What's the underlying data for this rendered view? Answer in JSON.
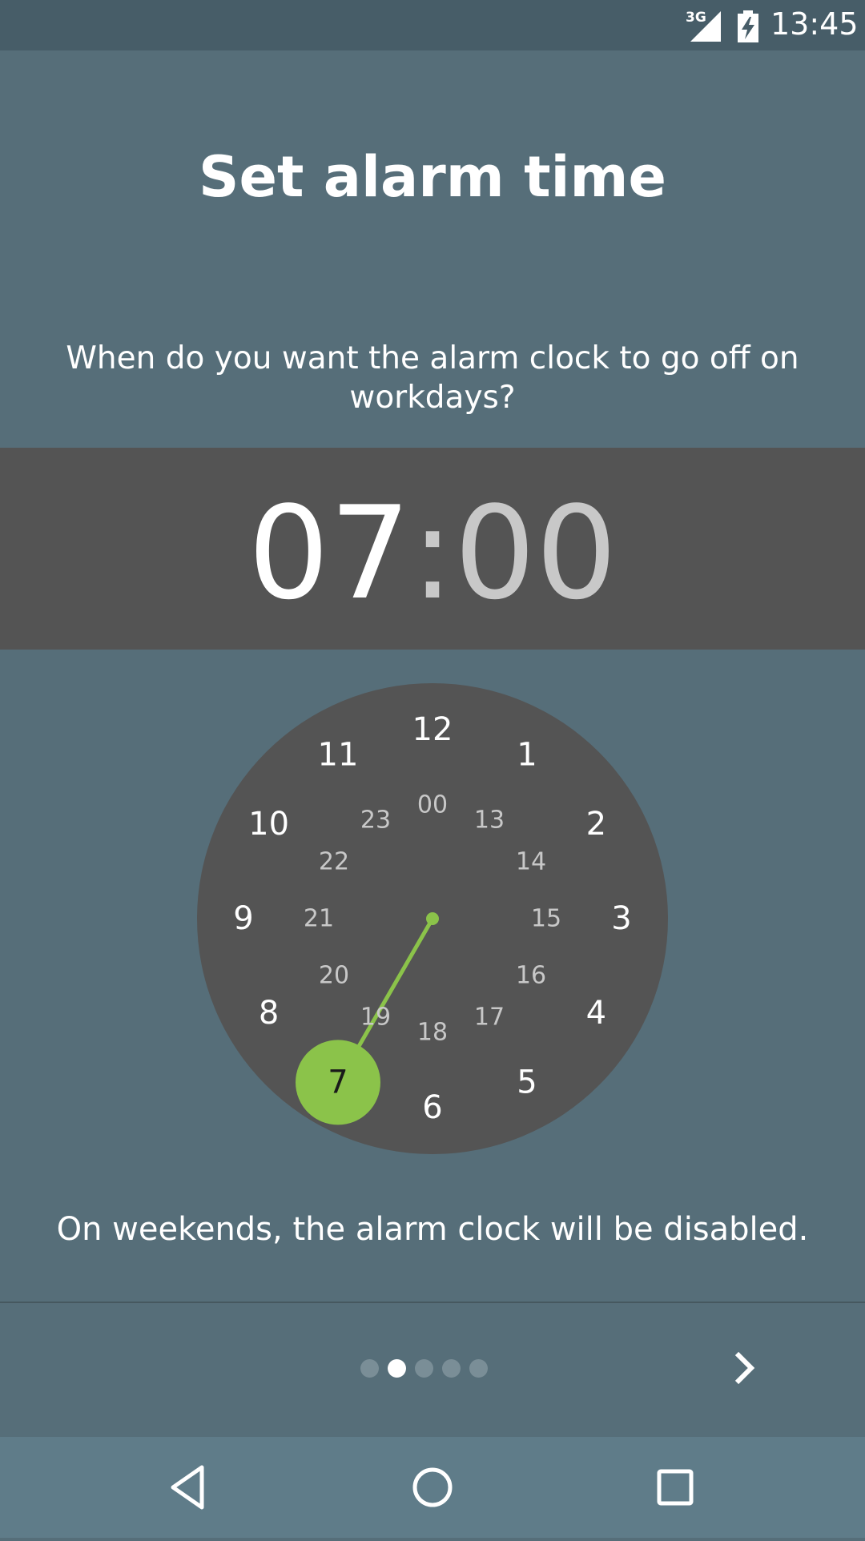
{
  "status_bar": {
    "network": "3G",
    "time": "13:45",
    "icons": [
      "signal-icon",
      "battery-charging-icon"
    ]
  },
  "title": "Set alarm time",
  "question": "When do you want the alarm clock to go off on workdays?",
  "time": {
    "hours": "07",
    "separator": ":",
    "minutes": "00"
  },
  "dial": {
    "outer_hours": [
      "12",
      "1",
      "2",
      "3",
      "4",
      "5",
      "6",
      "7",
      "8",
      "9",
      "10",
      "11"
    ],
    "inner_hours": [
      "00",
      "13",
      "14",
      "15",
      "16",
      "17",
      "18",
      "19",
      "20",
      "21",
      "22",
      "23"
    ],
    "selected_hour": "7",
    "accent_color": "#8bc34a",
    "face_color": "#545454"
  },
  "weekend_note": "On weekends, the alarm clock will be disabled.",
  "pager": {
    "total": 5,
    "active_index": 1
  },
  "next_icon": "chevron-right-icon",
  "nav": [
    "back-icon",
    "home-icon",
    "recents-icon"
  ],
  "colors": {
    "background": "#566e79",
    "status_bar": "#475d68",
    "nav_bar": "#5f7c89"
  }
}
